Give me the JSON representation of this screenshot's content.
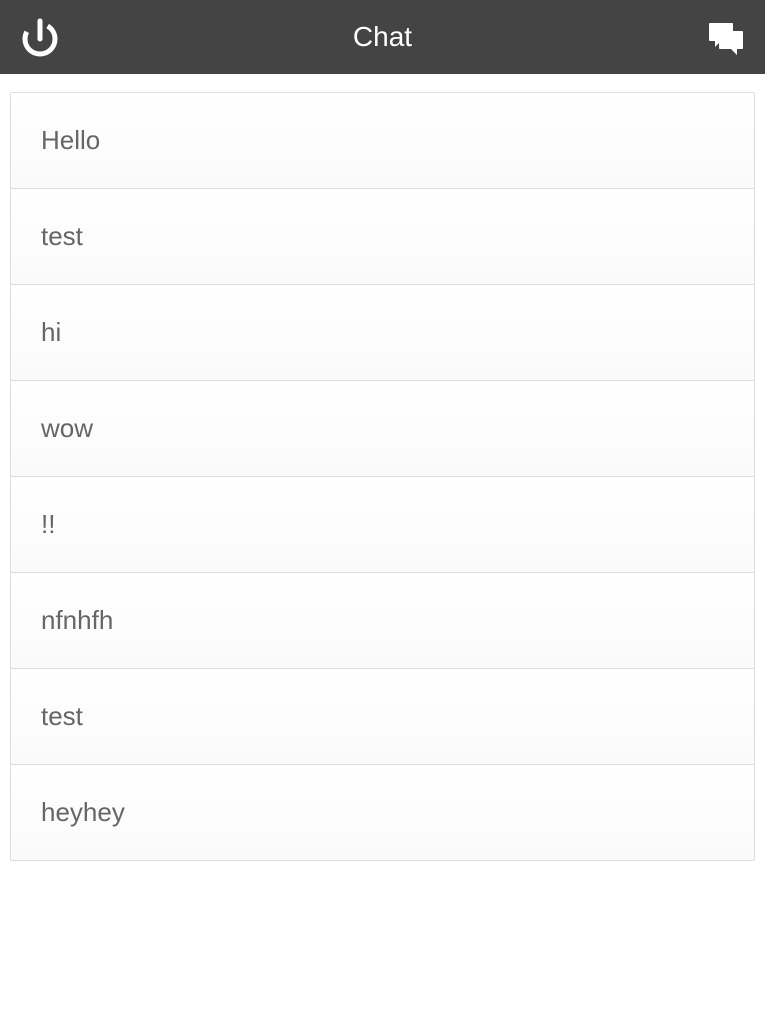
{
  "header": {
    "title": "Chat"
  },
  "messages": [
    "Hello",
    "test",
    "hi",
    "wow",
    "!!",
    "nfnhfh",
    "test",
    "heyhey"
  ]
}
